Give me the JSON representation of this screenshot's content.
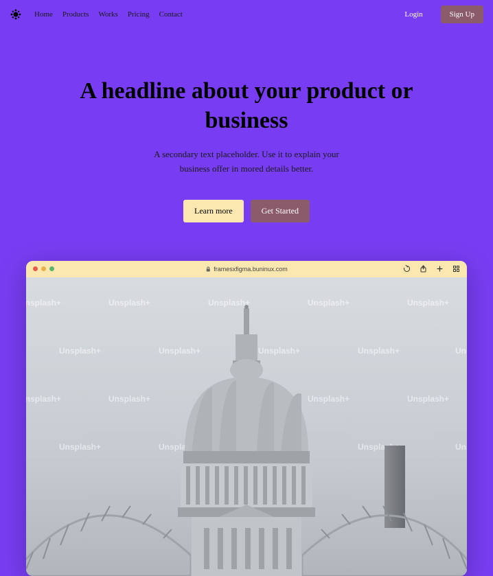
{
  "nav": {
    "items": [
      "Home",
      "Products",
      "Works",
      "Pricing",
      "Contact"
    ]
  },
  "auth": {
    "login": "Login",
    "signup": "Sign Up"
  },
  "hero": {
    "headline": "A headline about your product or business",
    "subhead": "A secondary text placeholder. Use it to explain your business offer in mored details better.",
    "learn_more": "Learn more",
    "get_started": "Get Started"
  },
  "browser": {
    "url": "framesxfigma.buninux.com",
    "watermark": "Unsplash+"
  },
  "colors": {
    "traffic_red": "#E85C4A",
    "traffic_yellow": "#E8B14A",
    "traffic_green": "#5AB56A"
  }
}
